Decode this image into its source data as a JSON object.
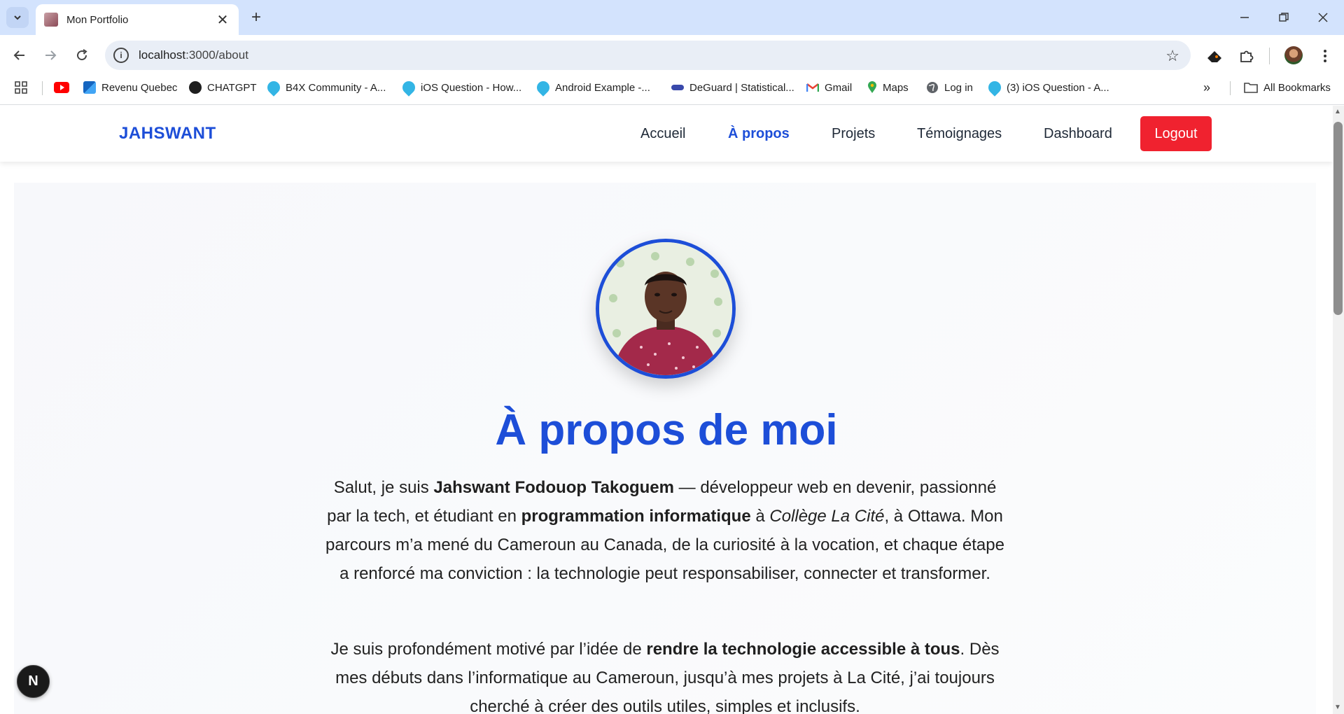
{
  "browser": {
    "tab_title": "Mon Portfolio",
    "url_host": "localhost",
    "url_path": ":3000/about",
    "bookmarks": [
      {
        "label": "Revenu Quebec",
        "icon": "revenu-quebec-icon"
      },
      {
        "label": "CHATGPT",
        "icon": "chatgpt-icon"
      },
      {
        "label": "B4X Community - A...",
        "icon": "b4x-icon"
      },
      {
        "label": "iOS Question - How...",
        "icon": "b4x-icon"
      },
      {
        "label": "Android Example -...",
        "icon": "b4x-icon"
      },
      {
        "label": "DeGuard | Statistical...",
        "icon": "deguard-icon"
      },
      {
        "label": "Gmail",
        "icon": "gmail-icon"
      },
      {
        "label": "Maps",
        "icon": "maps-icon"
      },
      {
        "label": "Log in",
        "icon": "globe-icon"
      },
      {
        "label": "(3) iOS Question - A...",
        "icon": "b4x-icon"
      }
    ],
    "all_bookmarks": "All Bookmarks",
    "colors": {
      "tabbar": "#d3e3fd",
      "omnibox": "#e9eef6"
    }
  },
  "site": {
    "brand": "JAHSWANT",
    "nav": [
      "Accueil",
      "À propos",
      "Projets",
      "Témoignages",
      "Dashboard"
    ],
    "active_nav": "À propos",
    "logout": "Logout",
    "colors": {
      "primary": "#1d4ed8",
      "logout": "#f0222f"
    }
  },
  "about": {
    "heading": "À propos de moi",
    "p1": {
      "t1": "Salut, je suis ",
      "b1": "Jahswant Fodouop Takoguem",
      "t2": " — développeur web en devenir, passionné par la tech, et étudiant en ",
      "b2": "programmation informatique",
      "t3": " à ",
      "i1": "Collège La Cité",
      "t4": ", à Ottawa. Mon parcours m’a mené du Cameroun au Canada, de la curiosité à la vocation, et chaque étape a renforcé ma conviction : la technologie peut responsabiliser, connecter et transformer."
    },
    "p2": {
      "t1": "Je suis profondément motivé par l’idée de ",
      "b1": "rendre la technologie accessible à tous",
      "t2": ". Dès mes débuts dans l’informatique au Cameroun, jusqu’à mes projets à La Cité, j’ai toujours cherché à créer des outils utiles, simples et inclusifs."
    }
  },
  "dev_badge": "N"
}
